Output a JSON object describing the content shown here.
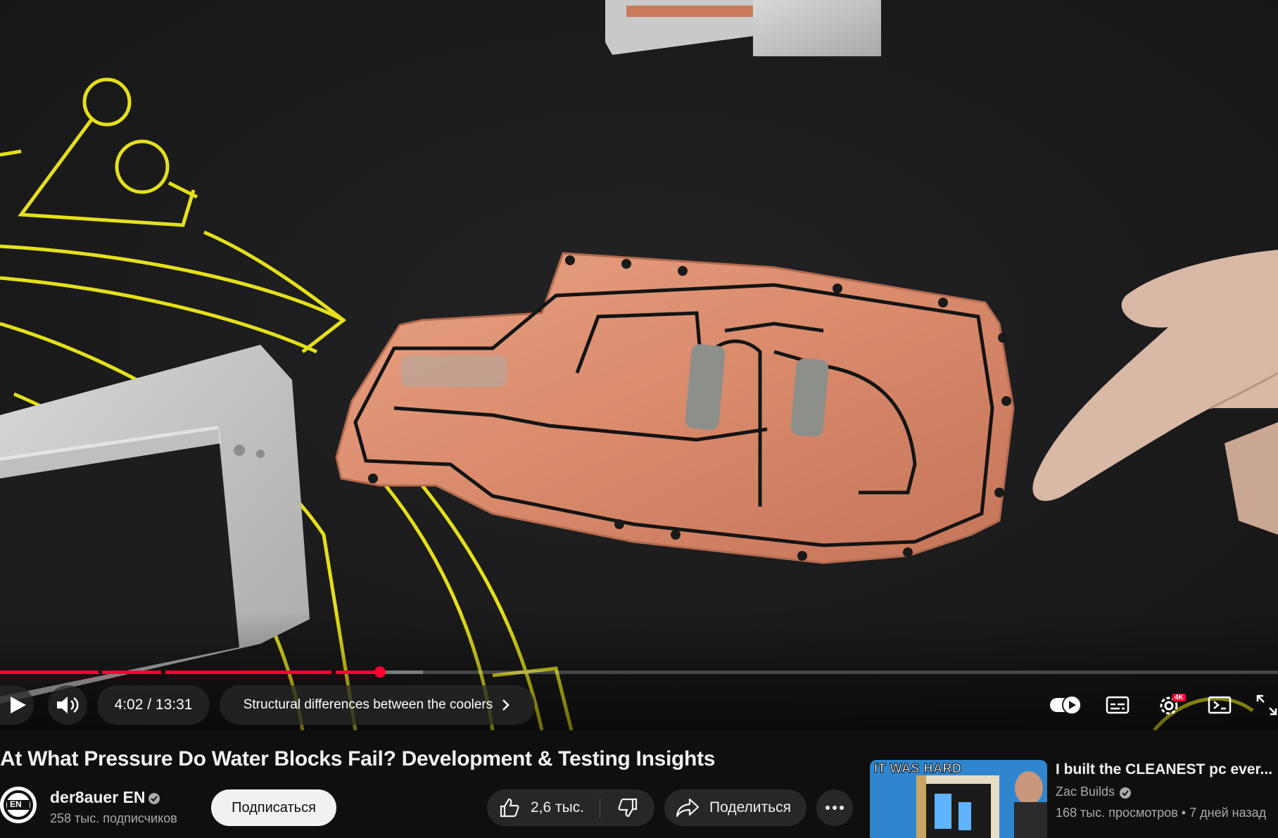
{
  "player": {
    "time": "4:02 / 13:31",
    "chapter": "Structural differences between the coolers",
    "progress_fraction": 0.298,
    "settings_badge": "4K"
  },
  "video": {
    "title": "At What Pressure Do Water Blocks Fail? Development & Testing Insights"
  },
  "channel": {
    "name": "der8auer EN",
    "subscribers": "258 тыс. подписчиков",
    "avatar_text": "EN"
  },
  "actions": {
    "subscribe_label": "Подписаться",
    "like_count": "2,6 тыс.",
    "share_label": "Поделиться"
  },
  "recommendation": {
    "thumb_text": "IT WAS HARD",
    "title": "I built the CLEANEST pc ever...",
    "channel": "Zac Builds",
    "meta": "168 тыс. просмотров • 7 дней назад"
  },
  "colors": {
    "accent": "#ff0033",
    "background": "#0f0f0f",
    "copper": "#d9896a",
    "tape_yellow": "#e4e01a"
  }
}
